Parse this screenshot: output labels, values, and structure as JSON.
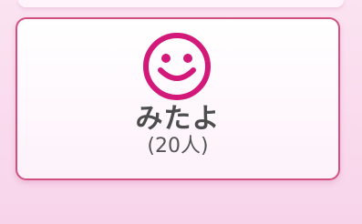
{
  "reaction": {
    "icon": "smiley-face-icon",
    "label": "みたよ",
    "count": "(20人)",
    "accent_color": "#d2197a",
    "border_color": "#d34f7f"
  }
}
